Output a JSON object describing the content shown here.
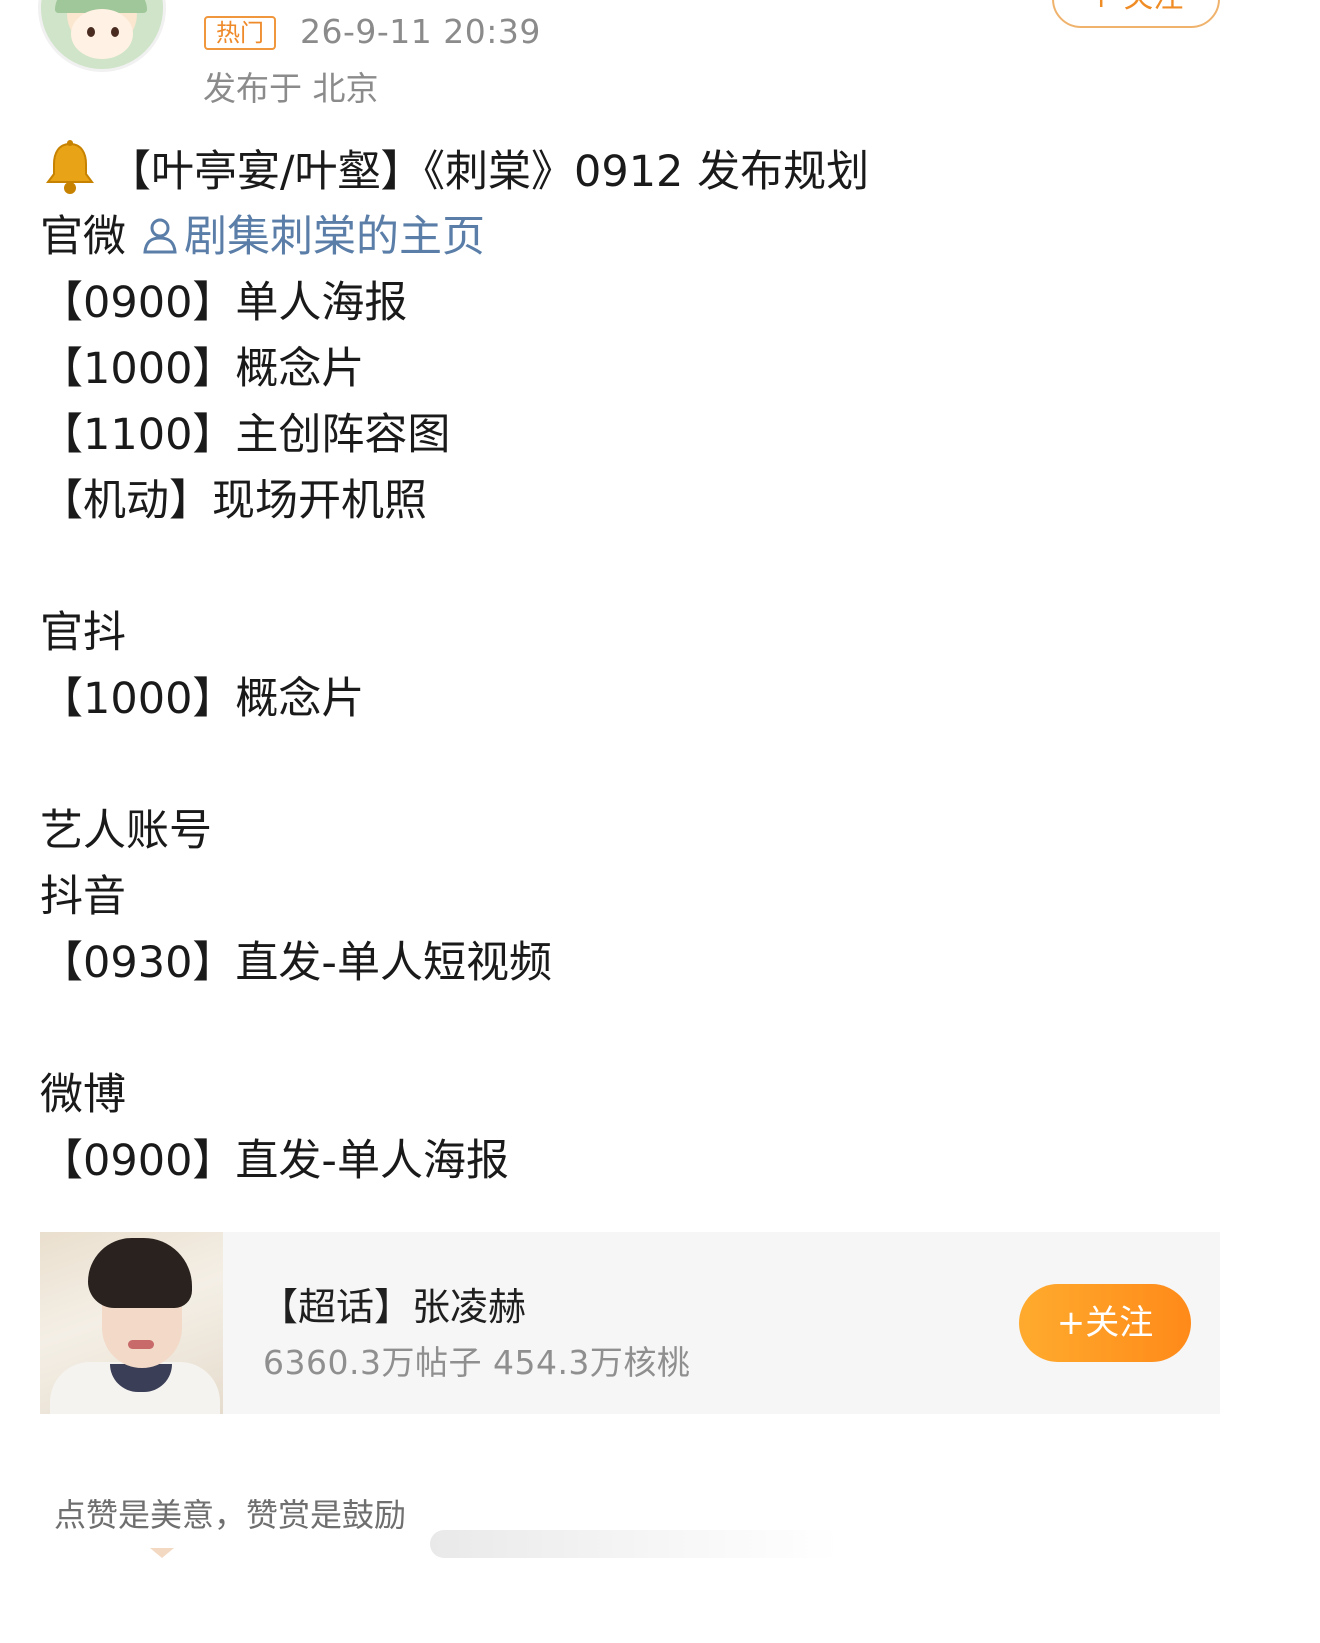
{
  "header": {
    "hot_tag": "热门",
    "time": "26-9-11 20:39",
    "location": "发布于 北京",
    "follow_label": "+ 关注"
  },
  "post": {
    "title": "【叶亭宴/叶壑】《刺棠》0912 发布规划",
    "official_weibo_label": "官微",
    "official_weibo_link": "剧集刺棠的主页",
    "weibo_items": [
      "【0900】单人海报",
      "【1000】概念片",
      "【1100】主创阵容图",
      "【机动】现场开机照"
    ],
    "douyin_official_label": "官抖",
    "douyin_official_items": [
      "【1000】概念片"
    ],
    "artist_accounts_label": "艺人账号",
    "artist_douyin_label": "抖音",
    "artist_douyin_items": [
      "【0930】直发-单人短视频"
    ],
    "artist_weibo_label": "微博",
    "artist_weibo_items": [
      "【0900】直发-单人海报"
    ]
  },
  "topic_card": {
    "title": "【超话】张凌赫",
    "stats": "6360.3万帖子 454.3万核桃",
    "follow_label": "+关注"
  },
  "footer": {
    "reward_text": "点赞是美意，赞赏是鼓励"
  },
  "icons": {
    "bell": "bell-icon",
    "person": "person-icon",
    "accent_color": "#ff8a19",
    "link_color": "#5a7ea8"
  }
}
